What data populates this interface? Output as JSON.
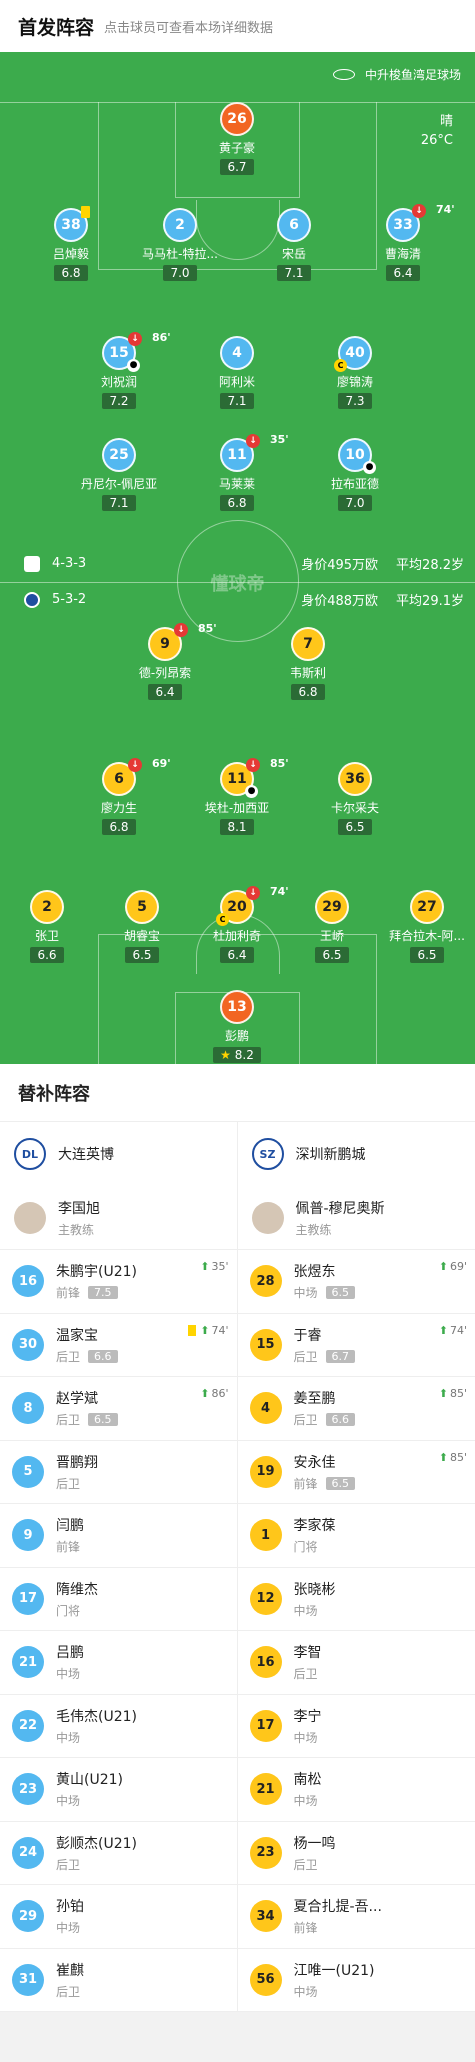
{
  "header": {
    "title": "首发阵容",
    "subtitle": "点击球员可查看本场详细数据"
  },
  "pitch": {
    "stadium": "中升梭鱼湾足球场",
    "weather": "晴",
    "temp": "26°C",
    "watermark": "懂球帝"
  },
  "home_team": {
    "formation": "4-3-3",
    "value": "身价495万欧",
    "avg_age": "平均28.2岁"
  },
  "away_team": {
    "formation": "5-3-2",
    "value": "身价488万欧",
    "avg_age": "平均29.1岁"
  },
  "home_players": [
    {
      "num": "26",
      "name": "黄子豪",
      "rating": "6.7"
    },
    {
      "num": "38",
      "name": "吕焯毅",
      "rating": "6.8"
    },
    {
      "num": "2",
      "name": "马马杜-特拉...",
      "rating": "7.0"
    },
    {
      "num": "6",
      "name": "宋岳",
      "rating": "7.1"
    },
    {
      "num": "33",
      "name": "曹海清",
      "rating": "6.4",
      "sub": "74'"
    },
    {
      "num": "15",
      "name": "刘祝润",
      "rating": "7.2",
      "sub": "86'"
    },
    {
      "num": "4",
      "name": "阿利米",
      "rating": "7.1"
    },
    {
      "num": "40",
      "name": "廖锦涛",
      "rating": "7.3"
    },
    {
      "num": "25",
      "name": "丹尼尔-佩尼亚",
      "rating": "7.1"
    },
    {
      "num": "11",
      "name": "马莱莱",
      "rating": "6.8",
      "sub": "35'"
    },
    {
      "num": "10",
      "name": "拉布亚德",
      "rating": "7.0"
    }
  ],
  "away_players": [
    {
      "num": "9",
      "name": "德-列昂索",
      "rating": "6.4",
      "sub": "85'"
    },
    {
      "num": "7",
      "name": "韦斯利",
      "rating": "6.8"
    },
    {
      "num": "6",
      "name": "廖力生",
      "rating": "6.8",
      "sub": "69'"
    },
    {
      "num": "11",
      "name": "埃杜-加西亚",
      "rating": "8.1",
      "sub": "85'"
    },
    {
      "num": "36",
      "name": "卡尔采夫",
      "rating": "6.5"
    },
    {
      "num": "2",
      "name": "张卫",
      "rating": "6.6"
    },
    {
      "num": "5",
      "name": "胡睿宝",
      "rating": "6.5"
    },
    {
      "num": "20",
      "name": "杜加利奇",
      "rating": "6.4",
      "sub": "74'"
    },
    {
      "num": "29",
      "name": "王峤",
      "rating": "6.5"
    },
    {
      "num": "27",
      "name": "拜合拉木-阿...",
      "rating": "6.5"
    },
    {
      "num": "13",
      "name": "彭鹏",
      "rating": "8.2"
    }
  ],
  "subs": {
    "title": "替补阵容",
    "home": {
      "team": "大连英博",
      "coach": "李国旭",
      "coach_role": "主教练",
      "players": [
        {
          "num": "16",
          "name": "朱鹏宇(U21)",
          "pos": "前锋",
          "rating": "7.5",
          "in": "35'"
        },
        {
          "num": "30",
          "name": "温家宝",
          "pos": "后卫",
          "rating": "6.6",
          "in": "74'"
        },
        {
          "num": "8",
          "name": "赵学斌",
          "pos": "后卫",
          "rating": "6.5",
          "in": "86'"
        },
        {
          "num": "5",
          "name": "晋鹏翔",
          "pos": "后卫"
        },
        {
          "num": "9",
          "name": "闫鹏",
          "pos": "前锋"
        },
        {
          "num": "17",
          "name": "隋维杰",
          "pos": "门将"
        },
        {
          "num": "21",
          "name": "吕鹏",
          "pos": "中场"
        },
        {
          "num": "22",
          "name": "毛伟杰(U21)",
          "pos": "中场"
        },
        {
          "num": "23",
          "name": "黄山(U21)",
          "pos": "中场"
        },
        {
          "num": "24",
          "name": "彭顺杰(U21)",
          "pos": "后卫"
        },
        {
          "num": "29",
          "name": "孙铂",
          "pos": "中场"
        },
        {
          "num": "31",
          "name": "崔麒",
          "pos": "后卫"
        }
      ]
    },
    "away": {
      "team": "深圳新鹏城",
      "coach": "佩普-穆尼奥斯",
      "coach_role": "主教练",
      "players": [
        {
          "num": "28",
          "name": "张煜东",
          "pos": "中场",
          "rating": "6.5",
          "in": "69'"
        },
        {
          "num": "15",
          "name": "于睿",
          "pos": "后卫",
          "rating": "6.7",
          "in": "74'"
        },
        {
          "num": "4",
          "name": "姜至鹏",
          "pos": "后卫",
          "rating": "6.6",
          "in": "85'"
        },
        {
          "num": "19",
          "name": "安永佳",
          "pos": "前锋",
          "rating": "6.5",
          "in": "85'"
        },
        {
          "num": "1",
          "name": "李家葆",
          "pos": "门将"
        },
        {
          "num": "12",
          "name": "张晓彬",
          "pos": "中场"
        },
        {
          "num": "16",
          "name": "李智",
          "pos": "后卫"
        },
        {
          "num": "17",
          "name": "李宁",
          "pos": "中场"
        },
        {
          "num": "21",
          "name": "南松",
          "pos": "中场"
        },
        {
          "num": "23",
          "name": "杨一鸣",
          "pos": "后卫"
        },
        {
          "num": "34",
          "name": "夏合扎提-吾...",
          "pos": "前锋"
        },
        {
          "num": "56",
          "name": "江唯一(U21)",
          "pos": "中场"
        }
      ]
    }
  }
}
